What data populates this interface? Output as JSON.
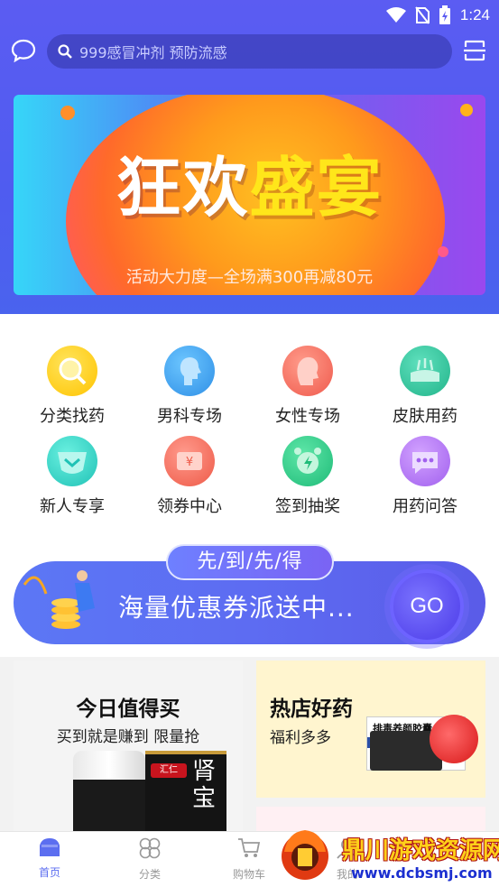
{
  "status_bar": {
    "time": "1:24",
    "icons": [
      "wifi-icon",
      "no-sim-icon",
      "battery-charging-icon"
    ]
  },
  "header": {
    "search_placeholder": "999感冒冲剂  预防流感",
    "left_icon": "chat-icon",
    "right_icon": "scan-icon"
  },
  "banner": {
    "title_white": "狂欢",
    "title_yellow": "盛宴",
    "subtitle": "活动大力度—全场满300再减80元"
  },
  "categories": [
    {
      "label": "分类找药",
      "icon": "magnifier-icon",
      "color": "#ffd21a"
    },
    {
      "label": "男科专场",
      "icon": "male-head-icon",
      "color": "#3fa9f5"
    },
    {
      "label": "女性专场",
      "icon": "female-head-icon",
      "color": "#f2665a"
    },
    {
      "label": "皮肤用药",
      "icon": "skin-icon",
      "color": "#37c9a1"
    },
    {
      "label": "新人专享",
      "icon": "gift-icon",
      "color": "#2fd2c4"
    },
    {
      "label": "领券中心",
      "icon": "coupon-icon",
      "color": "#f26b5a"
    },
    {
      "label": "签到抽奖",
      "icon": "alarm-clock-icon",
      "color": "#2dca8a"
    },
    {
      "label": "用药问答",
      "icon": "chat-bubble-icon",
      "color": "#b477f2"
    }
  ],
  "promo": {
    "tag": "先/到/先/得",
    "text": "海量优惠券派送中...",
    "button": "GO"
  },
  "cards": {
    "daily": {
      "title": "今日值得买",
      "subtitle": "买到就是赚到 限量抢",
      "product_text": "肾宝",
      "product_brand": "汇仁"
    },
    "hot": {
      "title": "热店好药",
      "subtitle": "福利多多",
      "product_text": "排毒养颜胶囊"
    }
  },
  "tabbar": [
    {
      "label": "首页",
      "icon": "home-icon",
      "active": true
    },
    {
      "label": "分类",
      "icon": "category-icon",
      "active": false
    },
    {
      "label": "购物车",
      "icon": "cart-icon",
      "active": false
    },
    {
      "label": "我的",
      "icon": "user-icon",
      "active": false
    }
  ],
  "watermark": {
    "text": "鼎川游戏资源网",
    "url": "www.dcbsmj.com"
  }
}
